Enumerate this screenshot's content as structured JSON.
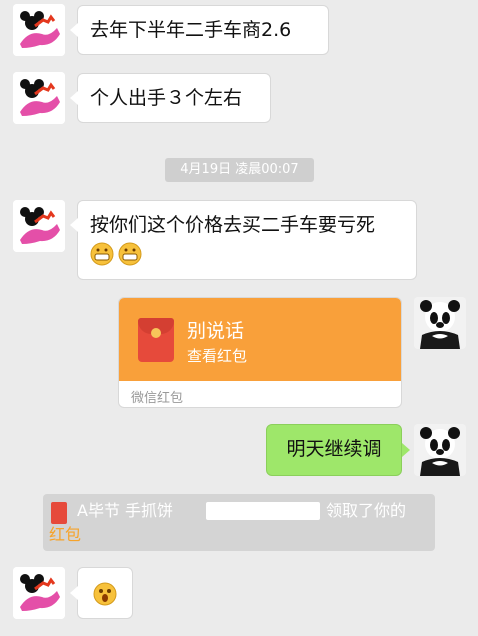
{
  "messages": [
    {
      "side": "left",
      "text": "去年下半年二手车商2.6"
    },
    {
      "side": "left",
      "text": "个人出手３个左右"
    },
    {
      "side": "left",
      "text": "按你们这个价格去买二手车要亏死"
    },
    {
      "side": "right",
      "type": "red-packet",
      "title": "别说话",
      "subtitle": "查看红包",
      "footer": "微信红包"
    },
    {
      "side": "right",
      "text": "明天继续调"
    }
  ],
  "timestamp": "4月19日 凌晨00:07",
  "notice": {
    "part1": "A毕节 手抓饼",
    "part2": "领取了你的",
    "part3": "红包"
  },
  "colors": {
    "background": "#ebebeb",
    "right_bubble": "#9ee76a",
    "red_packet": "#f9a03a",
    "notice_bg": "#d4d4d4",
    "notice_link": "#f6a32a"
  }
}
